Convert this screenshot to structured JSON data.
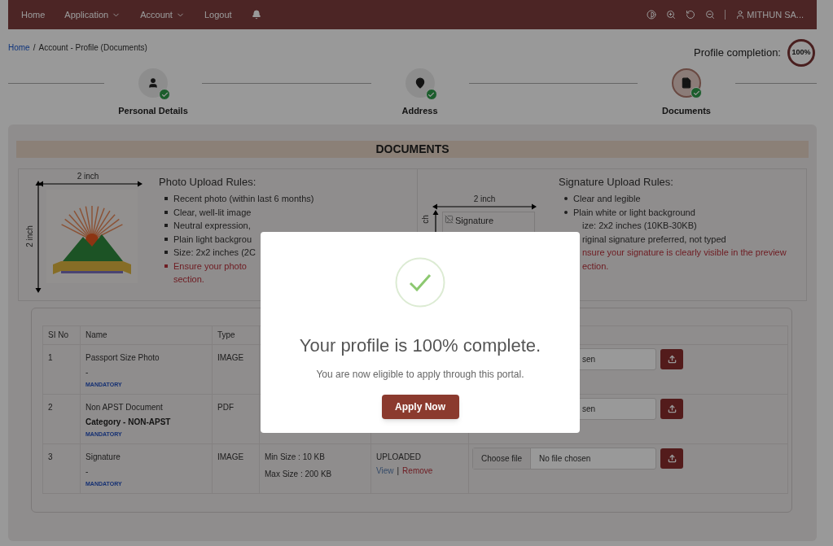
{
  "nav": {
    "items": [
      {
        "label": "Home",
        "dropdown": false
      },
      {
        "label": "Application",
        "dropdown": true
      },
      {
        "label": "Account",
        "dropdown": true
      },
      {
        "label": "Logout",
        "dropdown": false
      }
    ],
    "user": "MITHUN SA..."
  },
  "breadcrumb": {
    "items": [
      "Home",
      "Account - Profile (Documents)"
    ],
    "separator": "/"
  },
  "profile_completion": {
    "label": "Profile completion:",
    "value": "100%"
  },
  "steps": [
    {
      "label": "Personal Details",
      "completed": true,
      "selected": false
    },
    {
      "label": "Address",
      "completed": true,
      "selected": false
    },
    {
      "label": "Documents",
      "completed": true,
      "selected": true
    }
  ],
  "documents": {
    "title": "DOCUMENTS",
    "photo": {
      "width_label": "2 inch",
      "height_label": "2 inch",
      "title": "Photo Upload Rules:",
      "rules": [
        {
          "text": "Recent photo (within last 6 months)",
          "kind": "normal",
          "bullet": true
        },
        {
          "text": "Clear, well-lit image",
          "kind": "normal",
          "bullet": true
        },
        {
          "text": "Neutral expression,",
          "kind": "normal",
          "bullet": true
        },
        {
          "text": "Plain light backgrou",
          "kind": "normal",
          "bullet": true
        },
        {
          "text": "Size: 2x2 inches (2C",
          "kind": "normal",
          "bullet": true
        },
        {
          "text": "Ensure your photo",
          "kind": "warning",
          "bullet": true
        },
        {
          "text": "section.",
          "kind": "warning",
          "bullet": false
        }
      ]
    },
    "signature": {
      "width_label": "2 inch",
      "height_label": "ch",
      "image_alt": "Signature",
      "title": "Signature Upload Rules:",
      "rules": [
        {
          "text": "Clear and legible",
          "kind": "normal",
          "bullet": true
        },
        {
          "text": "Plain white or light background",
          "kind": "normal",
          "bullet": true
        },
        {
          "text": "ize: 2x2 inches (10KB-30KB)",
          "kind": "normal",
          "bullet": false
        },
        {
          "text": "riginal signature preferred, not typed",
          "kind": "normal",
          "bullet": false
        },
        {
          "text": "nsure your signature is clearly visible in the preview",
          "kind": "warning",
          "bullet": false
        },
        {
          "text": "ection.",
          "kind": "warning",
          "bullet": false
        }
      ]
    }
  },
  "table": {
    "columns": [
      "SI No",
      "Name",
      "Type"
    ],
    "rows": [
      {
        "sl": "1",
        "name": "Passport Size Photo",
        "category": "-",
        "tag": "MANDATORY",
        "type": "IMAGE",
        "file_text": "sen"
      },
      {
        "sl": "2",
        "name": "Non APST Document",
        "category": "Category - NON-APST",
        "tag": "MANDATORY",
        "type": "PDF",
        "file_text": "sen"
      },
      {
        "sl": "3",
        "name": "Signature",
        "category": "-",
        "tag": "MANDATORY",
        "type": "IMAGE",
        "size": [
          "Min Size : 10 KB",
          "Max Size : 200 KB"
        ],
        "status": "UPLOADED",
        "links": [
          {
            "label": "View",
            "kind": "view"
          },
          {
            "label": "Remove",
            "kind": "remove"
          }
        ],
        "link_separator": "|",
        "choose_button": "Choose file",
        "file_text": "No file chosen"
      }
    ]
  },
  "modal": {
    "title": "Your profile is 100% complete.",
    "message": "You are now eligible to apply through this portal.",
    "button": "Apply Now"
  }
}
